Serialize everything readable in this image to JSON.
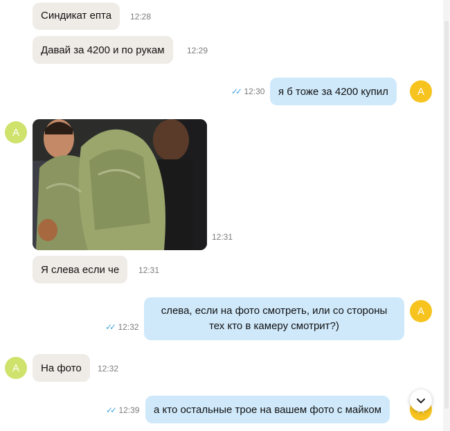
{
  "avatar_initial": "A",
  "colors": {
    "incoming_bubble": "#efebe6",
    "outgoing_bubble": "#cfe9fb",
    "read_check": "#3fa3e0",
    "contact_avatar": "#cfe26b",
    "own_avatar": "#f7c31e"
  },
  "messages": [
    {
      "direction": "incoming",
      "text": "Синдикат епта",
      "time": "12:28"
    },
    {
      "direction": "incoming",
      "text": "Давай за 4200 и по рукам",
      "time": "12:29"
    },
    {
      "direction": "outgoing",
      "text": "я б тоже за 4200 купил",
      "time": "12:30",
      "read": true
    },
    {
      "direction": "incoming",
      "type": "photo",
      "time": "12:31"
    },
    {
      "direction": "incoming",
      "text": "Я слева если че",
      "time": "12:31"
    },
    {
      "direction": "outgoing",
      "lines": [
        "слева, если на фото смотреть, или со стороны",
        "тех кто в камеру смотрит?)"
      ],
      "time": "12:32",
      "read": true
    },
    {
      "direction": "incoming",
      "text": "На фото",
      "time": "12:32"
    },
    {
      "direction": "outgoing",
      "text": "а кто остальные трое на вашем фото с майком",
      "time": "12:39",
      "read": true
    }
  ],
  "icons": {
    "read_receipt": "double-check-icon",
    "scroll_down": "chevron-down-icon"
  }
}
